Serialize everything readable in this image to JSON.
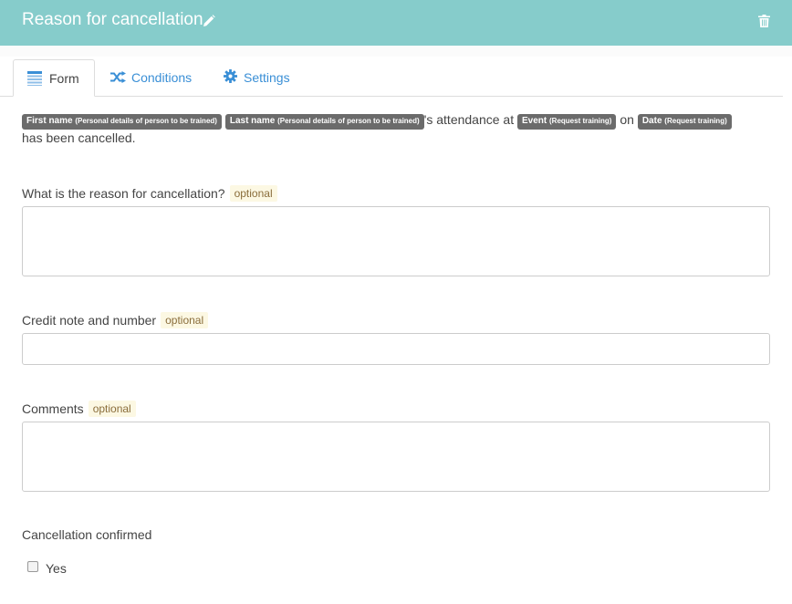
{
  "header": {
    "title": "Reason for cancellation",
    "background": "#86cccb",
    "edit_icon": "pencil-icon",
    "delete_icon": "trash-icon"
  },
  "tabs": [
    {
      "label": "Form",
      "icon": "list-icon",
      "active": true
    },
    {
      "label": "Conditions",
      "icon": "shuffle-icon",
      "active": false
    },
    {
      "label": "Settings",
      "icon": "gear-icon",
      "active": false
    }
  ],
  "intro": {
    "chip1_main": "First name",
    "chip1_sub": "(Personal details of person to be trained)",
    "chip2_main": "Last name",
    "chip2_sub": "(Personal details of person to be trained)",
    "text1": "'s attendance at",
    "chip3_main": "Event",
    "chip3_sub": "(Request training)",
    "text2": "on",
    "chip4_main": "Date",
    "chip4_sub": "(Request training)",
    "text3": "has been cancelled."
  },
  "fields": [
    {
      "label": "What is the reason for cancellation?",
      "optional": "optional",
      "value": ""
    },
    {
      "label": "Credit note and number",
      "optional": "optional",
      "value": ""
    },
    {
      "label": "Comments",
      "optional": "optional",
      "value": ""
    }
  ],
  "confirm": {
    "label": "Cancellation confirmed",
    "option": "Yes",
    "checked": false
  },
  "colors": {
    "link": "#3a8fd6",
    "chip": "#6b6b6b",
    "optional_bg": "#fcf8e3"
  }
}
